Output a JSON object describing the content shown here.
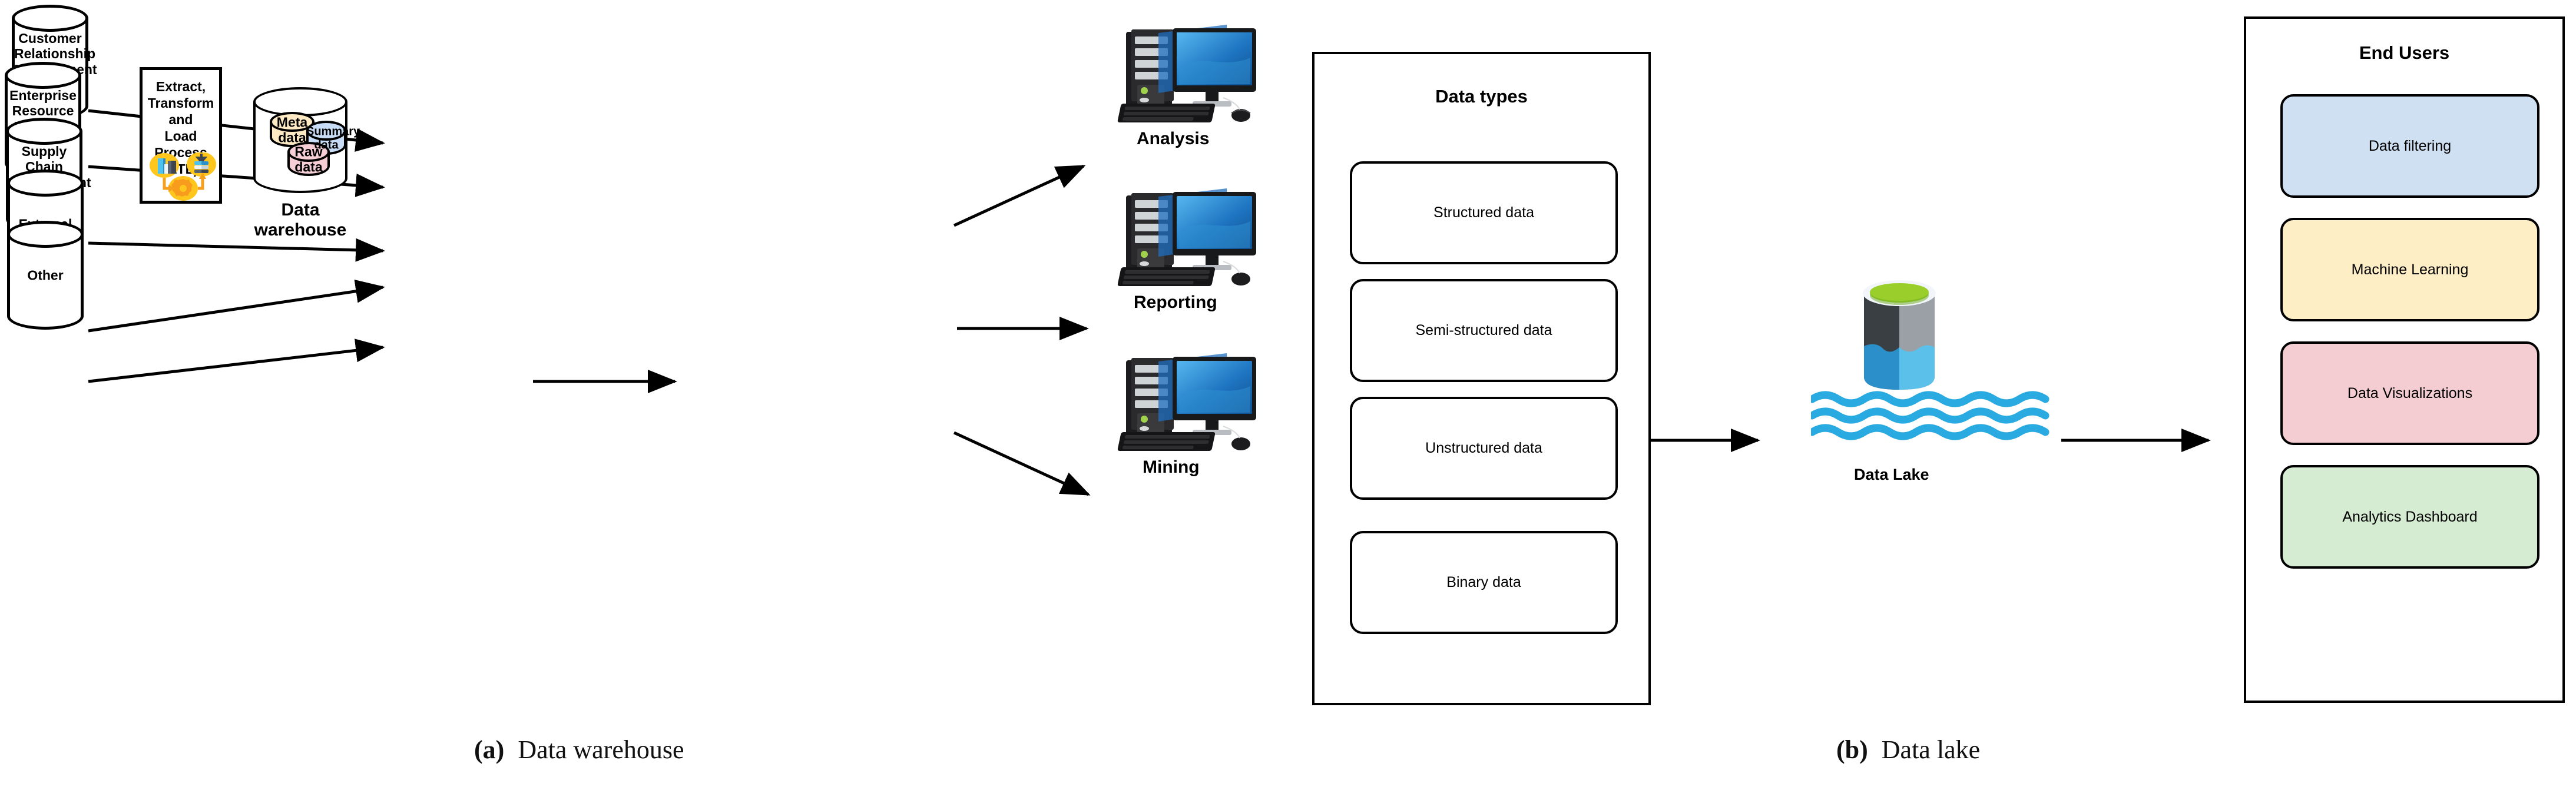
{
  "figure": {
    "caption_a_prefix": "(a)",
    "caption_a_text": "Data warehouse",
    "caption_b_prefix": "(b)",
    "caption_b_text": "Data lake"
  },
  "sources": {
    "items": [
      {
        "label": "Customer\nRelationship\nManagement\n(CRM)"
      },
      {
        "label": "Enterprise\nResource\nPlanning\n(ERP)"
      },
      {
        "label": "Supply Chain\nManagement\n(SCM)"
      },
      {
        "label": "External"
      },
      {
        "label": "Other"
      }
    ]
  },
  "etl": {
    "title": "Extract,\nTransform and\nLoad Process\n(ETL)",
    "icons": [
      {
        "name": "bar-chart-icon",
        "color": "#ffc61e"
      },
      {
        "name": "database-load-icon",
        "color": "#ffc61e"
      },
      {
        "name": "gear-process-icon",
        "color": "#f79c1d"
      }
    ]
  },
  "warehouse": {
    "label": "Data warehouse",
    "stores": [
      {
        "label": "Meta\ndata",
        "color": "#fdeac4"
      },
      {
        "label": "Summary\ndata",
        "color": "#c9dcf5"
      },
      {
        "label": "Raw\ndata",
        "color": "#f6cfd6"
      }
    ]
  },
  "consumers": {
    "items": [
      {
        "label": "Analysis",
        "icon": "desktop-computer-icon"
      },
      {
        "label": "Reporting",
        "icon": "desktop-computer-icon"
      },
      {
        "label": "Mining",
        "icon": "desktop-computer-icon"
      }
    ]
  },
  "data_types": {
    "title": "Data types",
    "items": [
      {
        "label": "Structured data"
      },
      {
        "label": "Semi-structured data"
      },
      {
        "label": "Unstructured data"
      },
      {
        "label": "Binary data"
      }
    ]
  },
  "data_lake": {
    "label": "Data Lake",
    "icon": "data-lake-cylinder-icon",
    "colors": {
      "rim": "#9ace2b",
      "shell_dark": "#3a3f44",
      "shell_light": "#9aa0a6",
      "water": "#29abe2",
      "water_light": "#5bc0ea"
    }
  },
  "end_users": {
    "title": "End Users",
    "items": [
      {
        "label": "Data filtering",
        "color": "#cfe0f2"
      },
      {
        "label": "Machine Learning",
        "color": "#fdeec6"
      },
      {
        "label": "Data Visualizations",
        "color": "#f4cdd2"
      },
      {
        "label": "Analytics Dashboard",
        "color": "#d6ecd2"
      }
    ]
  }
}
